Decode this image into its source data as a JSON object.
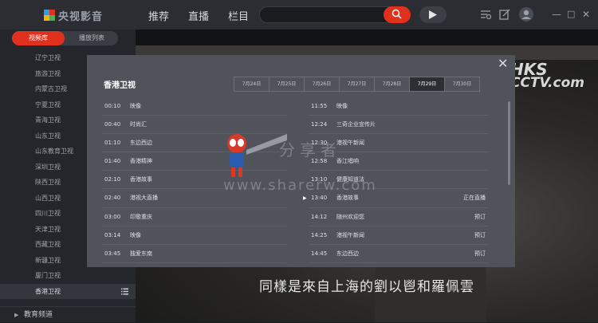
{
  "app": {
    "name": "央视影音"
  },
  "nav": [
    "推荐",
    "直播",
    "栏目"
  ],
  "window_controls": [
    "—",
    "□",
    "✕"
  ],
  "sidebar": {
    "tabs": [
      "视频库",
      "播放列表"
    ],
    "active_tab": "视频库",
    "channels": [
      "辽宁卫视",
      "旅游卫视",
      "内蒙古卫视",
      "宁夏卫视",
      "青海卫视",
      "山东卫视",
      "山东教育卫视",
      "深圳卫视",
      "陕西卫视",
      "山西卫视",
      "四川卫视",
      "天津卫视",
      "西藏卫视",
      "新疆卫视",
      "厦门卫视",
      "香港卫视"
    ],
    "selected_channel": "香港卫视",
    "footer": "教育频道"
  },
  "video": {
    "logo_line1": "HKS",
    "logo_line2": "CCTV.com",
    "subtitle": "同樣是來自上海的劉以鬯和羅佩雲"
  },
  "modal": {
    "title": "香港卫视",
    "close": "✕",
    "dates": [
      "7月24日",
      "7月25日",
      "7月26日",
      "7月27日",
      "7月28日",
      "7月29日",
      "7月30日"
    ],
    "selected_date": "7月29日",
    "left_column": [
      {
        "time": "00:10",
        "name": "映像",
        "status": ""
      },
      {
        "time": "00:40",
        "name": "时尚汇",
        "status": ""
      },
      {
        "time": "01:10",
        "name": "东边西边",
        "status": ""
      },
      {
        "time": "01:40",
        "name": "香港精神",
        "status": ""
      },
      {
        "time": "02:10",
        "name": "香港故事",
        "status": ""
      },
      {
        "time": "02:40",
        "name": "港视大直播",
        "status": ""
      },
      {
        "time": "03:00",
        "name": "印歌重庆",
        "status": ""
      },
      {
        "time": "03:14",
        "name": "映像",
        "status": ""
      },
      {
        "time": "03:45",
        "name": "独爱东南",
        "status": ""
      }
    ],
    "right_column": [
      {
        "time": "11:55",
        "name": "映像",
        "status": ""
      },
      {
        "time": "12:24",
        "name": "三奇企业宣传片",
        "status": ""
      },
      {
        "time": "12:30",
        "name": "港视午新闻",
        "status": ""
      },
      {
        "time": "12:58",
        "name": "香江唱响",
        "status": ""
      },
      {
        "time": "13:10",
        "name": "健康知道法",
        "status": ""
      },
      {
        "time": "13:40",
        "name": "香港故事",
        "status": "正在直播",
        "playing": true
      },
      {
        "time": "14:12",
        "name": "随州欢迎您",
        "status": "预订"
      },
      {
        "time": "14:25",
        "name": "港视午新闻",
        "status": "预订"
      },
      {
        "time": "14:45",
        "name": "东边西边",
        "status": "预订"
      }
    ]
  },
  "watermark": {
    "text": "分享者",
    "url": "www.sharerw.com"
  },
  "colors": {
    "accent": "#e0301e",
    "topbar": "#2b2d33",
    "sidebar": "#24262b",
    "modal": "#505359"
  }
}
